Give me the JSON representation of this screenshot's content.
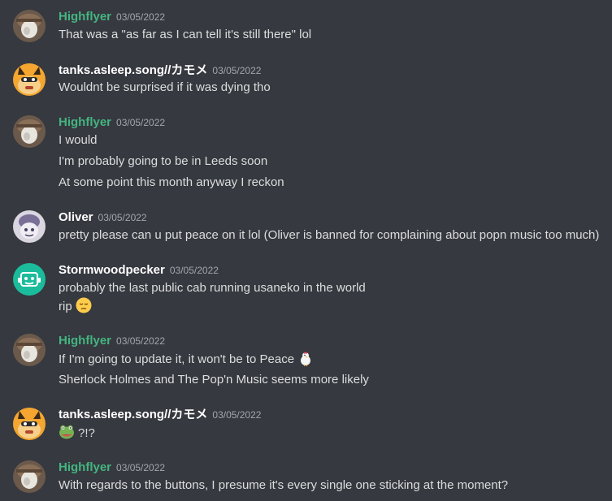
{
  "messages": [
    {
      "author": "Highflyer",
      "timestamp": "03/05/2022",
      "lines": [
        "That was a \"as far as I can tell it's still there\" lol"
      ]
    },
    {
      "author": "tanks.asleep.song//カモメ",
      "timestamp": "03/05/2022",
      "lines": [
        "Wouldnt be surprised if it was dying tho"
      ]
    },
    {
      "author": "Highflyer",
      "timestamp": "03/05/2022",
      "lines": [
        "I would",
        "I'm probably going to be in Leeds soon",
        "At some point this month anyway I reckon"
      ]
    },
    {
      "author": "Oliver",
      "timestamp": "03/05/2022",
      "lines": [
        "pretty please can u put peace on it lol (Oliver is banned for complaining about popn music too much)"
      ]
    },
    {
      "author": "Stormwoodpecker",
      "timestamp": "03/05/2022",
      "lines": [
        "probably the last public cab running usaneko in the world",
        "rip"
      ]
    },
    {
      "author": "Highflyer",
      "timestamp": "03/05/2022",
      "lines": [
        "If I'm going to update it, it won't be to Peace",
        "Sherlock Holmes and The Pop'n Music seems more likely"
      ]
    },
    {
      "author": "tanks.asleep.song//カモメ",
      "timestamp": "03/05/2022",
      "lines": [
        "?!?"
      ]
    },
    {
      "author": "Highflyer",
      "timestamp": "03/05/2022",
      "lines": [
        "With regards to the buttons, I presume it's every single one sticking at the moment?"
      ]
    }
  ],
  "colors": {
    "background": "#36393f",
    "username_default": "#ffffff",
    "username_role": "#43b581",
    "message_text": "#dcddde",
    "timestamp": "#a3a6aa"
  },
  "icons": {
    "pensive_emoji": "pensive-face-emoji",
    "chicken_emoji": "chicken-emoji",
    "frog_emoji": "frog-emoji"
  }
}
